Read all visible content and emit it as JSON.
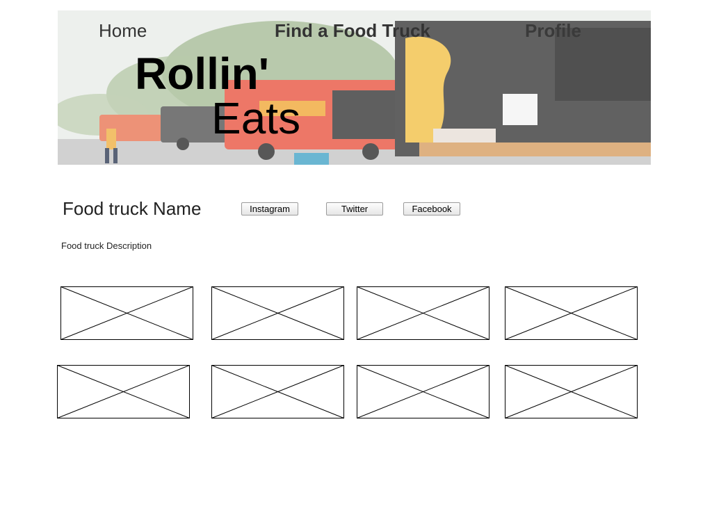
{
  "nav": {
    "home_label": "Home",
    "find_label": "Find a Food Truck",
    "profile_label": "Profile"
  },
  "logo": {
    "line1": "Rollin'",
    "line2": "Eats"
  },
  "truck": {
    "name": "Food truck Name",
    "description": "Food truck Description",
    "social": {
      "instagram_label": "Instagram",
      "twitter_label": "Twitter",
      "facebook_label": "Facebook"
    }
  },
  "gallery": {
    "image_count": 8
  },
  "colors": {
    "background": "#ffffff",
    "text": "#333333",
    "logo_text": "#000000",
    "placeholder_stroke": "#000000"
  }
}
